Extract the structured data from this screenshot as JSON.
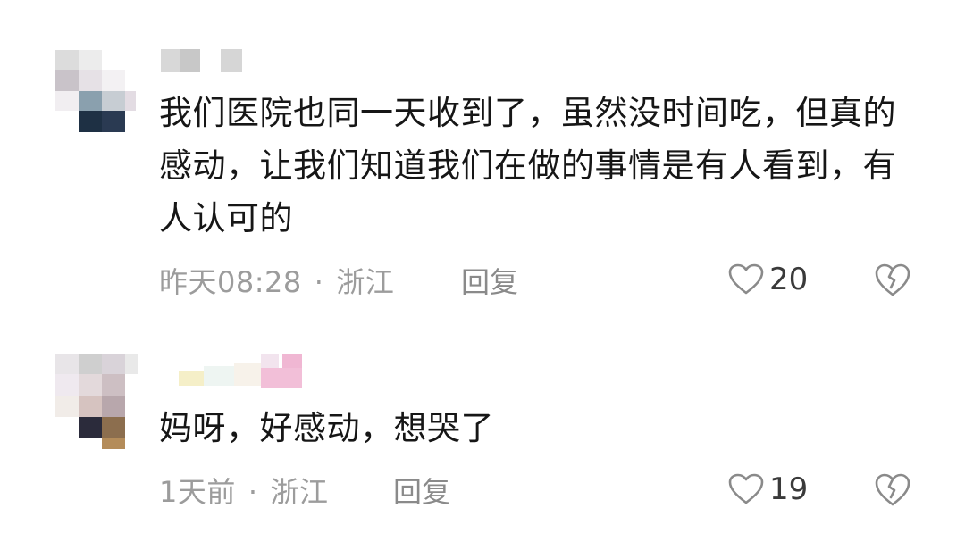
{
  "comments": [
    {
      "text": "我们医院也同一天收到了，虽然没时间吃，但真的感动，让我们知道我们在做的事情是有人看到，有人认可的",
      "time": "昨天08:28",
      "dot": "·",
      "location": "浙江",
      "reply_label": "回复",
      "likes": "20",
      "like_icon": "heart-outline-icon",
      "dislike_icon": "broken-heart-icon"
    },
    {
      "text": "妈呀，好感动，想哭了",
      "time": "1天前",
      "dot": "·",
      "location": "浙江",
      "reply_label": "回复",
      "likes": "19",
      "like_icon": "heart-outline-icon",
      "dislike_icon": "broken-heart-icon"
    }
  ],
  "colors": {
    "text": "#161616",
    "meta": "#9c9c9c",
    "icon": "#8a8a8a"
  }
}
